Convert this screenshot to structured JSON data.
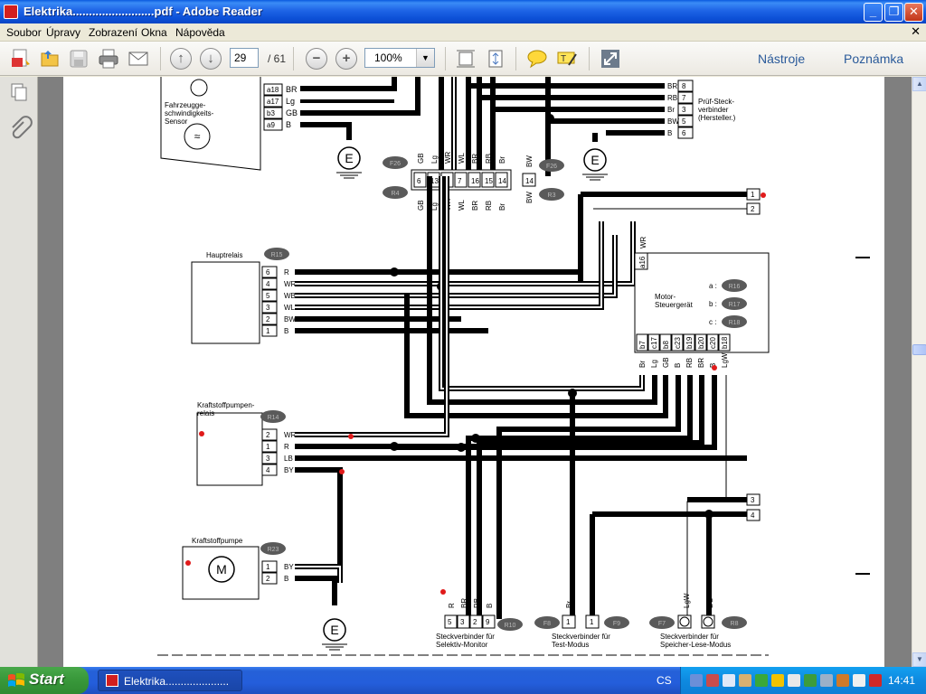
{
  "window": {
    "title": "Elektrika.........................pdf - Adobe Reader"
  },
  "menu": {
    "items": [
      "Soubor",
      "Úpravy",
      "Zobrazení",
      "Okna",
      "Nápověda"
    ]
  },
  "toolbar": {
    "page_current": "29",
    "page_total": "/ 61",
    "zoom": "100%",
    "tools_label": "Nástroje",
    "comments_label": "Poznámka"
  },
  "diagram": {
    "top_left": {
      "label": "Fahrzeugge-\nschwindigkeits-\nSensor",
      "pins": [
        "a18",
        "a17",
        "b3",
        "a9"
      ],
      "wires": [
        "BR",
        "Lg",
        "GB",
        "B"
      ]
    },
    "test_connector": {
      "label": "Prüf-Steck-\nverbinder\n(Hersteller.)",
      "pins": [
        "8",
        "7",
        "3",
        "5",
        "6"
      ],
      "wires": [
        "BR",
        "RB",
        "Br",
        "BW",
        "B"
      ]
    },
    "ground_label": "E",
    "badges": [
      "F26",
      "F26",
      "R4",
      "R3",
      "R15",
      "R14",
      "R23",
      "R10",
      "F8",
      "F9",
      "F7",
      "R8",
      "R16",
      "R17",
      "R18"
    ],
    "junction_pins": [
      "6",
      "13",
      "5",
      "7",
      "16",
      "15",
      "14"
    ],
    "junction_wires": [
      "GB",
      "Lg",
      "WR",
      "WL",
      "BR",
      "RB",
      "Br"
    ],
    "hauptrelais": {
      "label": "Hauptrelais",
      "pins": [
        "6",
        "4",
        "5",
        "3",
        "2",
        "1"
      ],
      "wires": [
        "R",
        "WR",
        "WB",
        "WL",
        "BW",
        "B"
      ]
    },
    "pump_relay": {
      "label": "Kraftstoffpumpen-\nrelais",
      "pins": [
        "2",
        "1",
        "3",
        "4"
      ],
      "wires": [
        "WR",
        "R",
        "LB",
        "BY"
      ]
    },
    "pump": {
      "label": "Kraftstoffpumpe",
      "motor": "M",
      "pins": [
        "1",
        "2"
      ],
      "wires": [
        "BY",
        "B"
      ]
    },
    "ecu": {
      "label": "Motor-\nSteuergerät",
      "legend": [
        "a :",
        "b :",
        "c :"
      ],
      "pins": [
        "b7",
        "c17",
        "b8",
        "c23",
        "b19",
        "b20",
        "c20",
        "b18"
      ],
      "wires": [
        "Br",
        "Lg",
        "GB",
        "B",
        "RB",
        "BR",
        "B",
        "LgW"
      ],
      "top_pin": "a16",
      "top_wire": "WR"
    },
    "right_pins": [
      "1",
      "2",
      "3",
      "4"
    ],
    "selektiv": {
      "label": "Steckverbinder für\nSelektiv-Monitor",
      "pins": [
        "5",
        "3",
        "2",
        "9"
      ],
      "wires": [
        "R",
        "BR",
        "RB",
        "B"
      ]
    },
    "test_mode": {
      "label": "Steckverbinder für\nTest-Modus",
      "pins": [
        "1",
        "1"
      ],
      "wires": [
        "Br",
        "BG"
      ]
    },
    "memory_mode": {
      "label": "Steckverbinder für\nSpeicher-Lese-Modus",
      "wires": [
        "LgW",
        "BG"
      ]
    }
  },
  "taskbar": {
    "start_label": "Start",
    "task_label": "Elektrika.....................",
    "language": "CS",
    "clock": "14:41"
  }
}
